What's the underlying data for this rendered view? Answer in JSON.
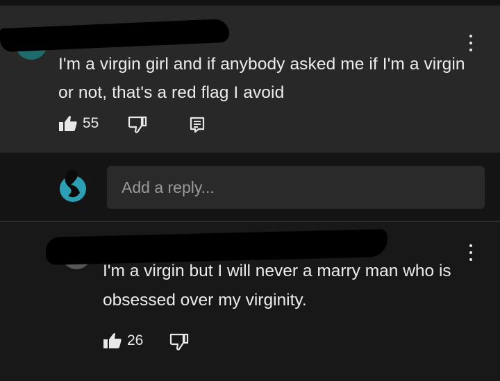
{
  "comment": {
    "text": "I'm a virgin girl and if anybody asked me if I'm a virgin or not, that's a red flag I avoid",
    "likes": "55"
  },
  "reply_box": {
    "placeholder": "Add a reply..."
  },
  "reply": {
    "text": "I'm a virgin but I will never a marry man who is obsessed over my virginity.",
    "likes": "26"
  },
  "icons": {
    "like": "thumbs-up-icon",
    "dislike": "thumbs-down-icon",
    "reply": "reply-icon",
    "more": "more-vertical-icon"
  },
  "colors": {
    "comment_background": "#282828",
    "page_background": "#181818",
    "input_background": "#2a2a2a",
    "avatar_teal": "#2d9fb5"
  }
}
